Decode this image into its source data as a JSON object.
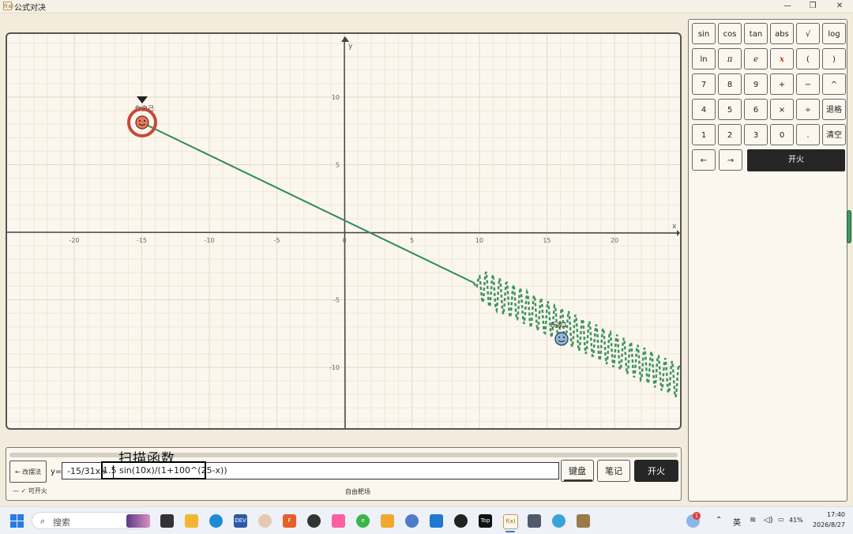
{
  "window": {
    "title": "公式对决",
    "icon_text": "f(x)"
  },
  "graph": {
    "x_ticks": [
      "-20",
      "-15",
      "-10",
      "-5",
      "0",
      "5",
      "10",
      "15",
      "20"
    ],
    "y_ticks": [
      "10",
      "5",
      "-5",
      "-10"
    ],
    "x_axis_label": "x",
    "y_axis_label": "y",
    "player1_name": "你自己",
    "player2_name": "玩家1",
    "line_color": "#2e8b57",
    "player1_color": "#d65c4a",
    "player2_color": "#5a8fb8"
  },
  "formula_panel": {
    "scan_label": "扫描函数",
    "back_button": "← 改摆法",
    "y_prefix": "y=",
    "formula_left": "-15/31x+",
    "formula_right": "1.5 sin(10x)/(1+100^(25-x))",
    "keyboard_button": "键盘",
    "notes_button": "笔记",
    "fire_button": "开火",
    "status_left": "—  ✓ 可开火",
    "status_center": "自由靶场"
  },
  "keyboard": {
    "rows": [
      [
        "sin",
        "cos",
        "tan",
        "abs",
        "√",
        "log"
      ],
      [
        "ln",
        "π",
        "e",
        "x",
        "(",
        ")"
      ],
      [
        "7",
        "8",
        "9",
        "+",
        "−",
        "^"
      ],
      [
        "4",
        "5",
        "6",
        "×",
        "÷",
        "退格"
      ],
      [
        "1",
        "2",
        "3",
        "0",
        ".",
        "清空"
      ]
    ],
    "arrow_left": "←",
    "arrow_right": "→",
    "fire": "开火"
  },
  "taskbar": {
    "search_placeholder": "搜索",
    "ime": "英",
    "battery": "41%",
    "time": "17:40",
    "date": "2026/8/27",
    "weather_badge": "1"
  }
}
